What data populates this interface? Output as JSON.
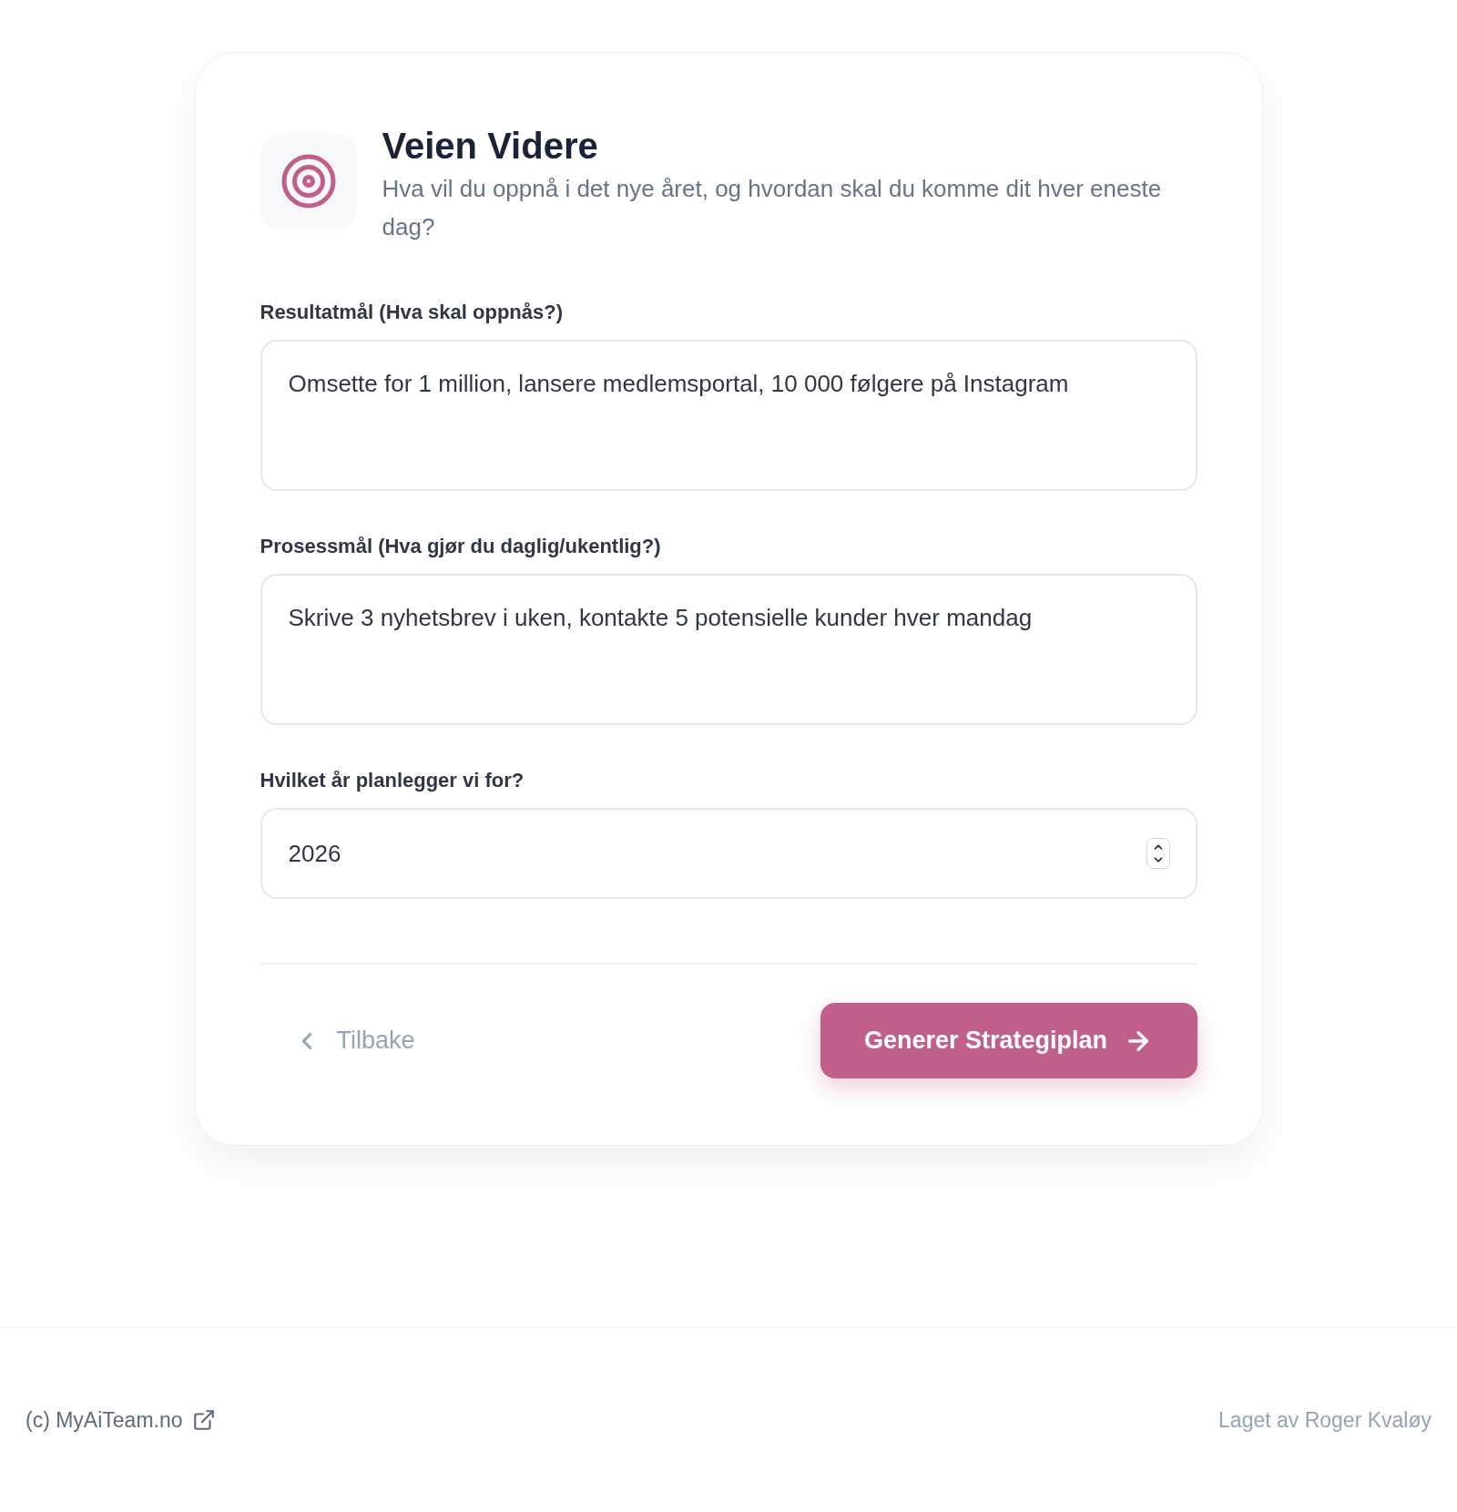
{
  "header": {
    "title": "Veien Videre",
    "subtitle": "Hva vil du oppnå i det nye året, og hvordan skal du komme dit hver eneste dag?"
  },
  "fields": [
    {
      "kind": "textarea",
      "label": "Resultatmål (Hva skal oppnås?)",
      "value": "Omsette for 1 million, lansere medlemsportal, 10 000 følgere på Instagram"
    },
    {
      "kind": "textarea",
      "label": "Prosessmål (Hva gjør du daglig/ukentlig?)",
      "value": "Skrive 3 nyhetsbrev i uken, kontakte 5 potensielle kunder hver mandag"
    },
    {
      "kind": "number",
      "label": "Hvilket år planlegger vi for?",
      "value": "2026"
    }
  ],
  "actions": {
    "back": "Tilbake",
    "submit": "Generer Strategiplan"
  },
  "footer": {
    "left": "(c) MyAiTeam.no",
    "right": "Laget av Roger Kvaløy"
  }
}
